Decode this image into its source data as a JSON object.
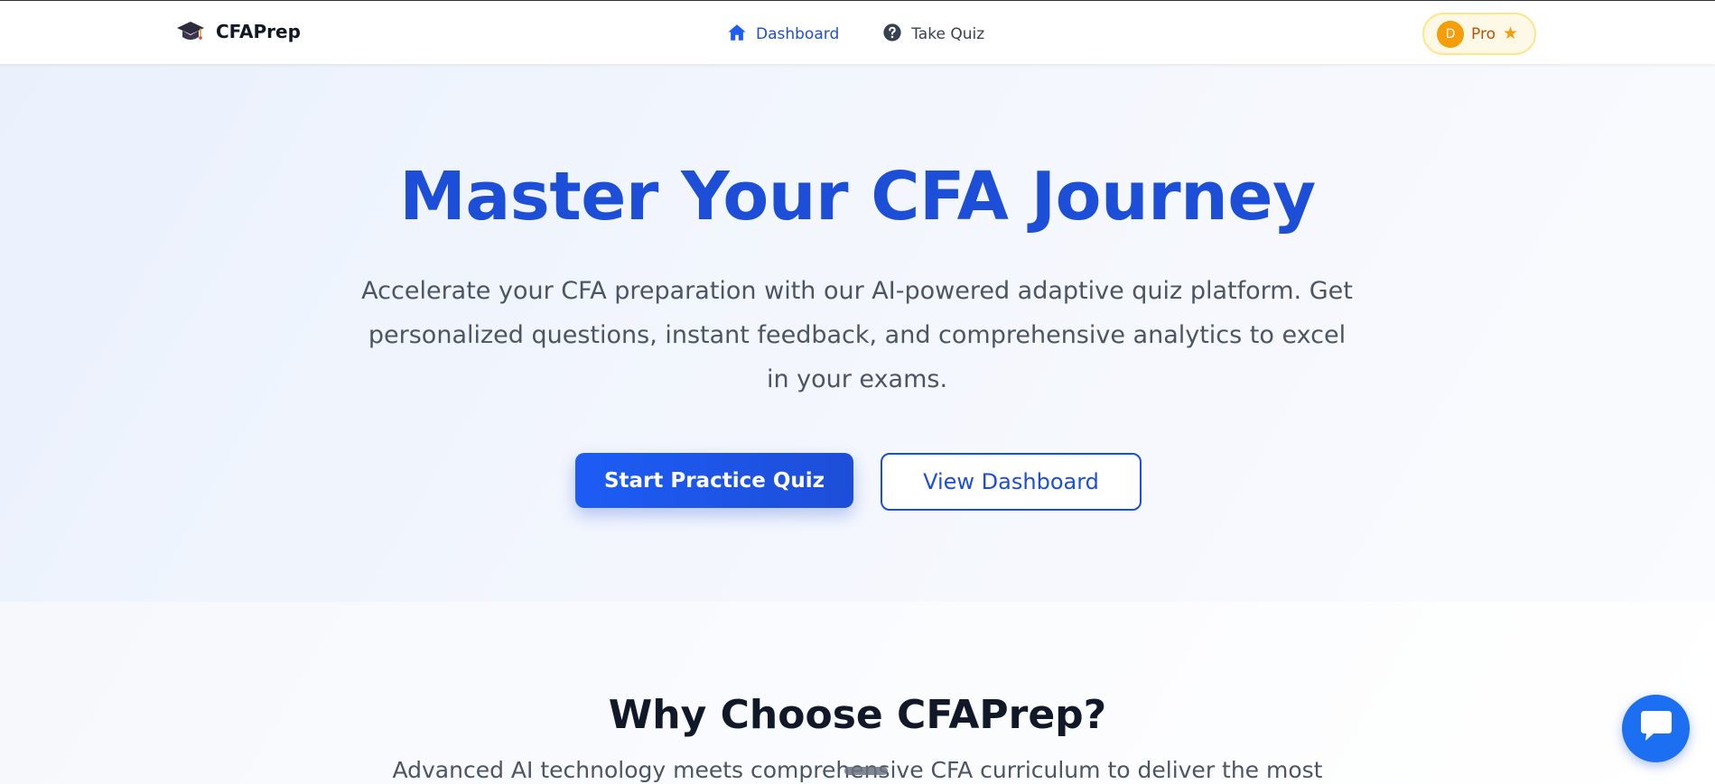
{
  "navbar": {
    "brand_name": "CFAPrep",
    "links": [
      {
        "label": "Dashboard",
        "icon": "home-icon",
        "active": true
      },
      {
        "label": "Take Quiz",
        "icon": "question-circle-icon",
        "active": false
      }
    ],
    "pro_badge": {
      "avatar_initial": "D",
      "label": "Pro",
      "icon": "star-icon"
    }
  },
  "hero": {
    "title": "Master Your CFA Journey",
    "subtitle": "Accelerate your CFA preparation with our AI-powered adaptive quiz platform. Get personalized questions, instant feedback, and comprehensive analytics to excel in your exams.",
    "primary_button": "Start Practice Quiz",
    "secondary_button": "View Dashboard"
  },
  "features": {
    "title": "Why Choose CFAPrep?",
    "subtitle": "Advanced AI technology meets comprehensive CFA curriculum to deliver the most"
  },
  "chat": {
    "icon": "chat-bubble-icon"
  },
  "colors": {
    "brand_blue": "#1d4ed8",
    "pro_gold": "#f59e0b",
    "heading_dark": "#111827",
    "body_gray": "#4b5563"
  }
}
